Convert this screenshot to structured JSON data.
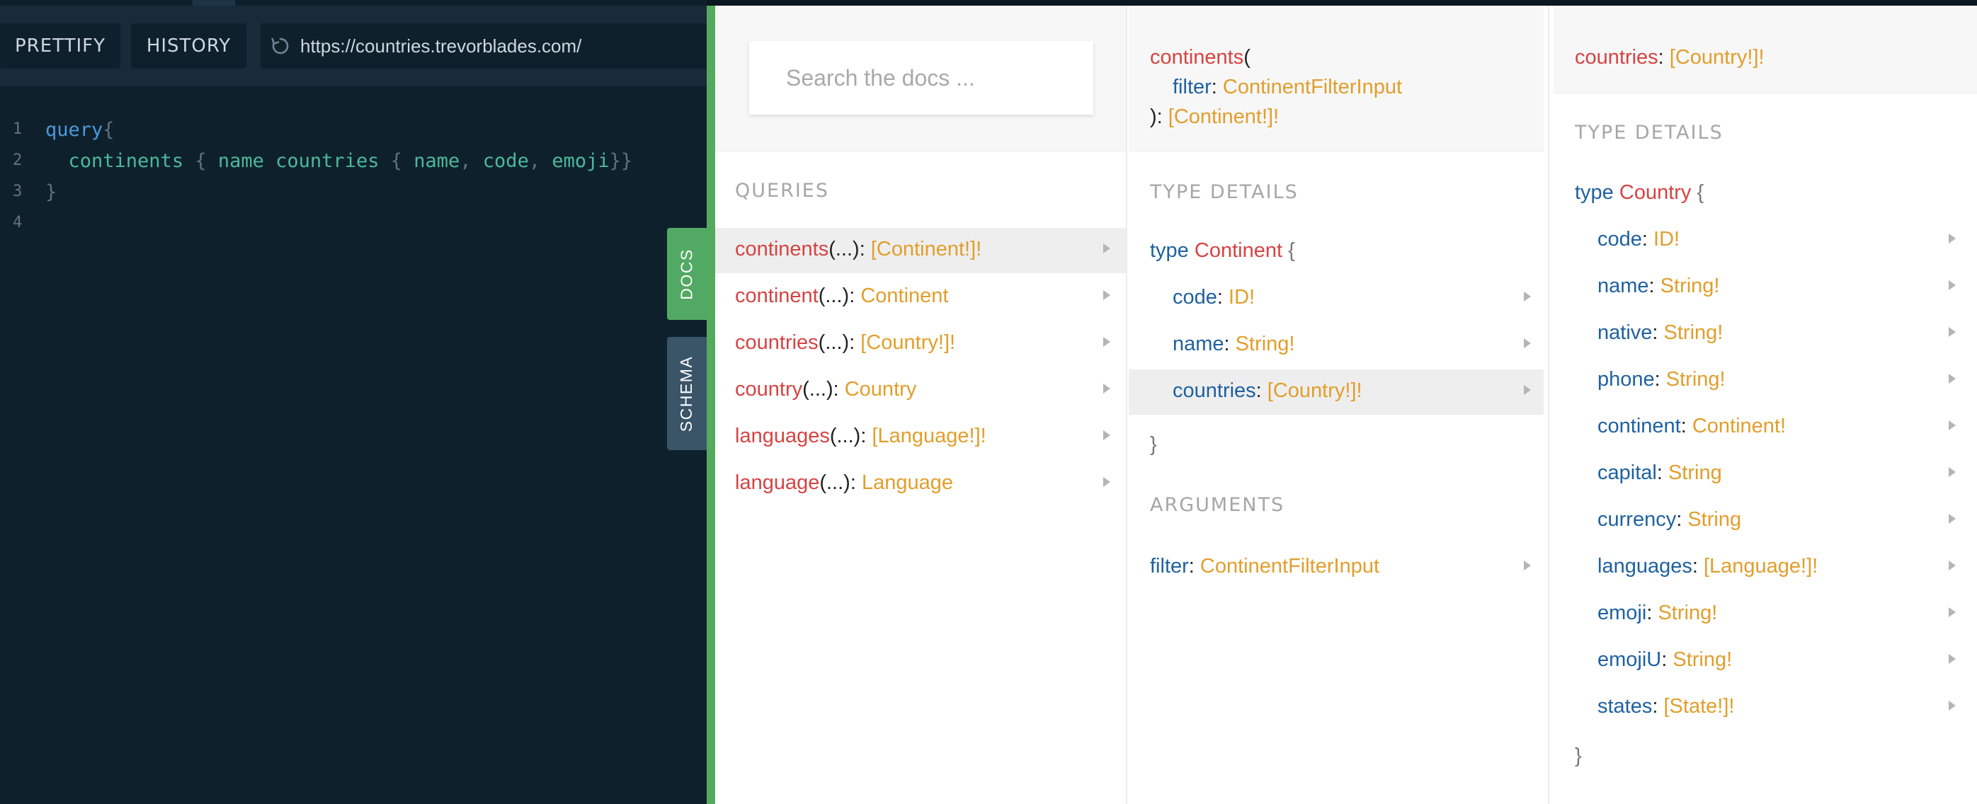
{
  "toolbar": {
    "prettify_label": "PRETTIFY",
    "history_label": "HISTORY",
    "endpoint_url": "https://countries.trevorblades.com/"
  },
  "editor": {
    "line_numbers": [
      "1",
      "2",
      "3",
      "4"
    ],
    "line1_keyword": "query",
    "line1_brace": "{",
    "line2_indent": "  ",
    "line2_field1": "continents",
    "line2_brace_open1": " { ",
    "line2_field2": "name",
    "line2_sp": " ",
    "line2_field3": "countries",
    "line2_brace_open2": " { ",
    "line2_field4": "name",
    "line2_comma1": ", ",
    "line2_field5": "code",
    "line2_comma2": ", ",
    "line2_field6": "emoji",
    "line2_brace_close": "}}",
    "line3_brace": "}"
  },
  "side_tabs": {
    "docs": "DOCS",
    "schema": "SCHEMA"
  },
  "docs": {
    "search_placeholder": "Search the docs ...",
    "queries_title": "QUERIES",
    "queries": [
      {
        "name": "continents",
        "args": "(...)",
        "sep": ": ",
        "type": "[Continent!]!"
      },
      {
        "name": "continent",
        "args": "(...)",
        "sep": ": ",
        "type": "Continent"
      },
      {
        "name": "countries",
        "args": "(...)",
        "sep": ": ",
        "type": "[Country!]!"
      },
      {
        "name": "country",
        "args": "(...)",
        "sep": ": ",
        "type": "Country"
      },
      {
        "name": "languages",
        "args": "(...)",
        "sep": ": ",
        "type": "[Language!]!"
      },
      {
        "name": "language",
        "args": "(...)",
        "sep": ": ",
        "type": "Language"
      }
    ],
    "continents_panel": {
      "title_name": "continents",
      "title_paren_open": "(",
      "title_arg_name": "filter",
      "title_arg_sep": ": ",
      "title_arg_type": "ContinentFilterInput",
      "title_paren_close": "): ",
      "title_return_type": "[Continent!]!",
      "type_details_title": "TYPE DETAILS",
      "type_kw": "type",
      "type_name": "Continent",
      "open_brace": "{",
      "fields": [
        {
          "name": "code",
          "sep": ": ",
          "type": "ID!"
        },
        {
          "name": "name",
          "sep": ": ",
          "type": "String!"
        },
        {
          "name": "countries",
          "sep": ": ",
          "type": "[Country!]!"
        }
      ],
      "close_brace": "}",
      "arguments_title": "ARGUMENTS",
      "arguments": [
        {
          "name": "filter",
          "sep": ": ",
          "type": "ContinentFilterInput"
        }
      ]
    },
    "countries_panel": {
      "title_name": "countries",
      "title_sep": ": ",
      "title_type": "[Country!]!",
      "type_details_title": "TYPE DETAILS",
      "type_kw": "type",
      "type_name": "Country",
      "open_brace": "{",
      "fields": [
        {
          "name": "code",
          "sep": ": ",
          "type": "ID!"
        },
        {
          "name": "name",
          "sep": ": ",
          "type": "String!"
        },
        {
          "name": "native",
          "sep": ": ",
          "type": "String!"
        },
        {
          "name": "phone",
          "sep": ": ",
          "type": "String!"
        },
        {
          "name": "continent",
          "sep": ": ",
          "type": "Continent!"
        },
        {
          "name": "capital",
          "sep": ": ",
          "type": "String"
        },
        {
          "name": "currency",
          "sep": ": ",
          "type": "String"
        },
        {
          "name": "languages",
          "sep": ": ",
          "type": "[Language!]!"
        },
        {
          "name": "emoji",
          "sep": ": ",
          "type": "String!"
        },
        {
          "name": "emojiU",
          "sep": ": ",
          "type": "String!"
        },
        {
          "name": "states",
          "sep": ": ",
          "type": "[State!]!"
        }
      ],
      "close_brace": "}"
    }
  },
  "colors": {
    "docs_accent": "#54aa5d",
    "field_red": "#d64343",
    "type_orange": "#e29e2b",
    "keyword_blue": "#1f61a0",
    "editor_bg": "#0f202d"
  }
}
